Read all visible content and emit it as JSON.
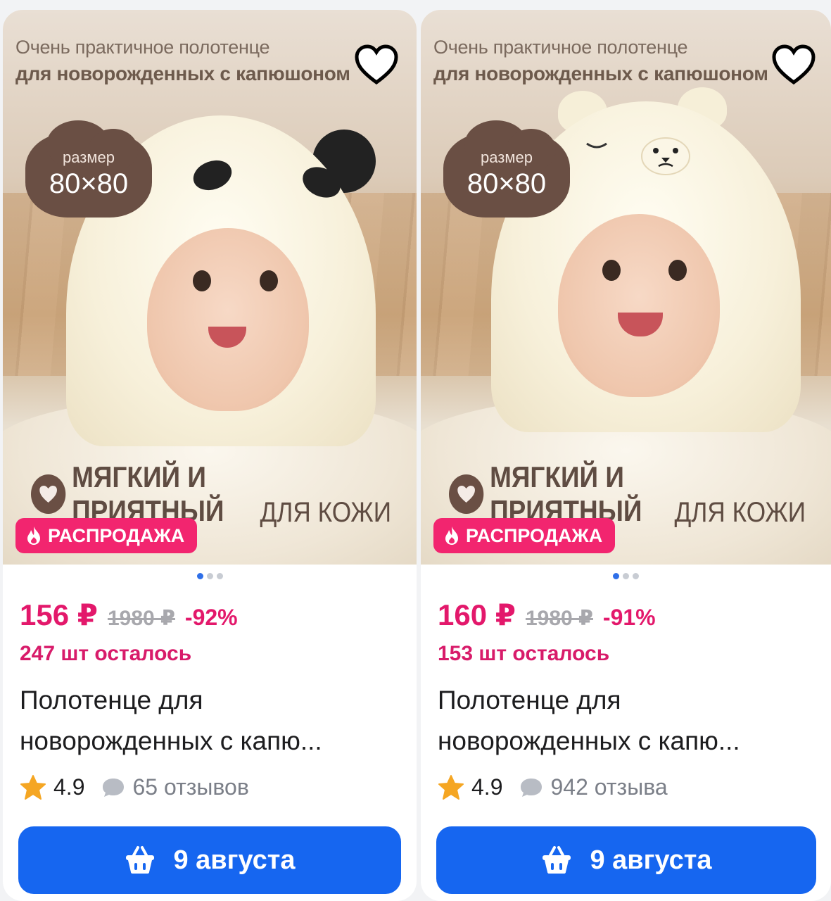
{
  "cards": [
    {
      "banner_line1": "Очень практичное полотенце",
      "banner_line2": "для новорожденных с капюшоном",
      "size_label": "размер",
      "size_value": "80×80",
      "soft_text": "МЯГКИЙ И ПРИЯТНЫЙ",
      "soft_sub": "ДЛЯ КОЖИ",
      "sale_label": "РАСПРОДАЖА",
      "price": "156 ₽",
      "old_price": "1980 ₽",
      "discount": "-92%",
      "stock": "247 шт осталось",
      "title": "Полотенце для новорожденных с капю...",
      "rating": "4.9",
      "reviews": "65 отзывов",
      "delivery": "9 августа",
      "hood_style": "panda"
    },
    {
      "banner_line1": "Очень практичное полотенце",
      "banner_line2": "для новорожденных с капюшоном",
      "size_label": "размер",
      "size_value": "80×80",
      "soft_text": "МЯГКИЙ И ПРИЯТНЫЙ",
      "soft_sub": "ДЛЯ КОЖИ",
      "sale_label": "РАСПРОДАЖА",
      "price": "160 ₽",
      "old_price": "1980 ₽",
      "discount": "-91%",
      "stock": "153 шт осталось",
      "title": "Полотенце для новорожденных с капю...",
      "rating": "4.9",
      "reviews": "942 отзыва",
      "delivery": "9 августа",
      "hood_style": "bear"
    }
  ],
  "colors": {
    "accent_pink": "#e3186b",
    "button_blue": "#1666f0",
    "star": "#f5a623"
  },
  "icons": {
    "favorite": "heart-outline-icon",
    "sale": "flame-icon",
    "rating": "star-icon",
    "reviews": "chat-bubble-icon",
    "delivery": "basket-icon"
  }
}
